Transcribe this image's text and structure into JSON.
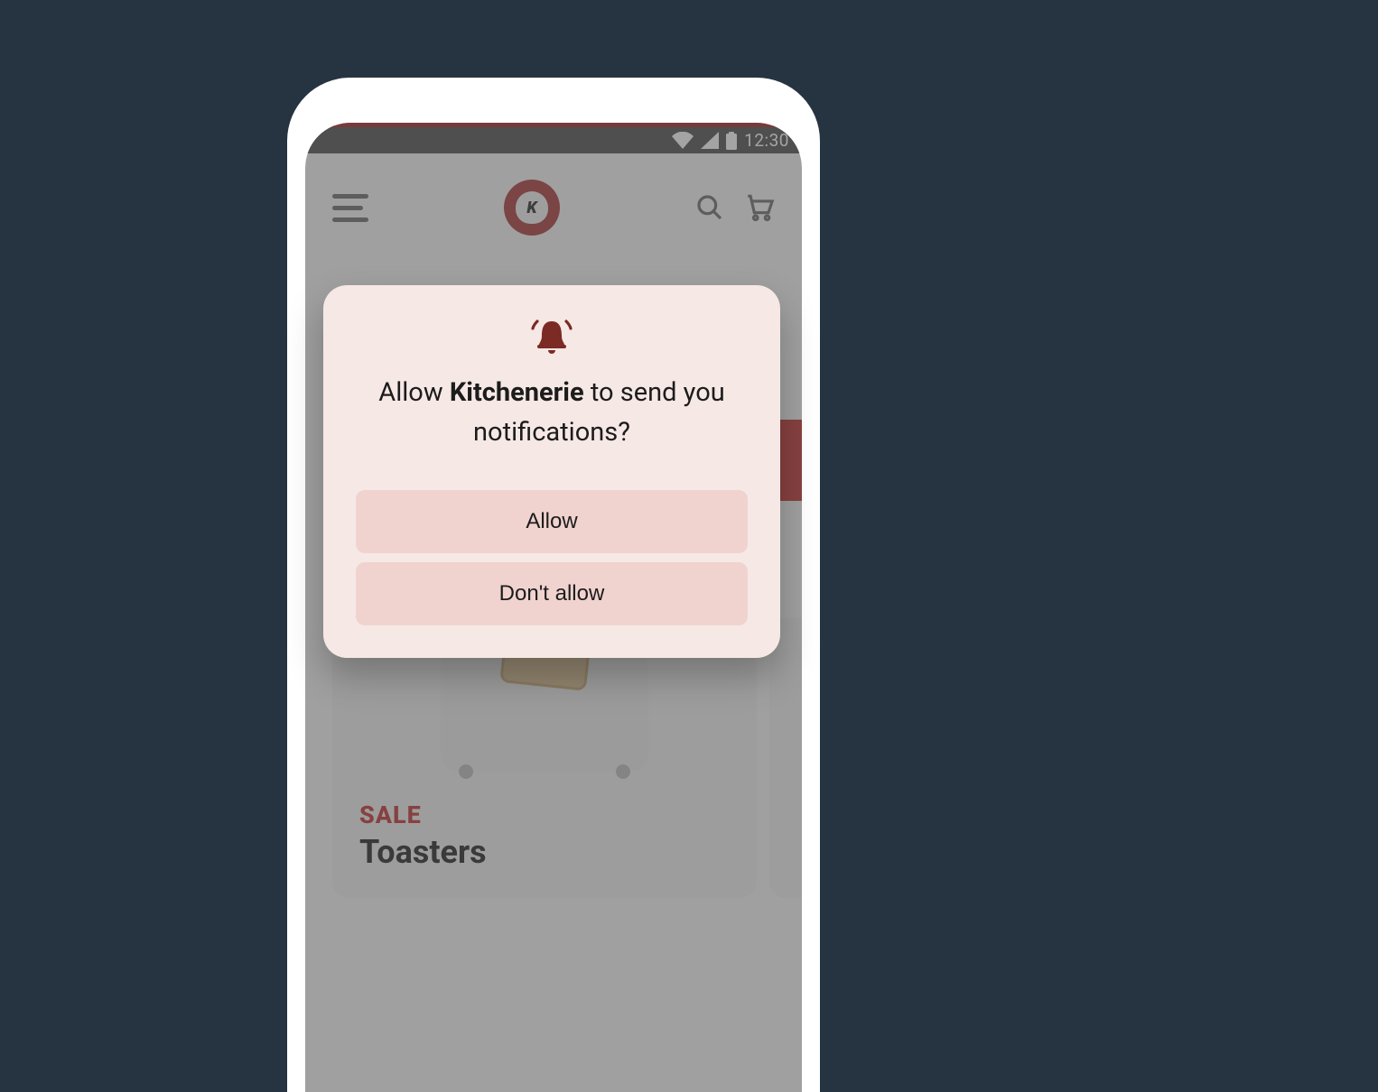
{
  "status_bar": {
    "time": "12:30"
  },
  "header": {
    "logo_letter": "K"
  },
  "product_card": {
    "tag": "SALE",
    "title": "Toasters"
  },
  "dialog": {
    "prefix": "Allow ",
    "app_name": "Kitchenerie",
    "suffix": " to send you notifications?",
    "allow_label": "Allow",
    "deny_label": "Don't allow"
  }
}
